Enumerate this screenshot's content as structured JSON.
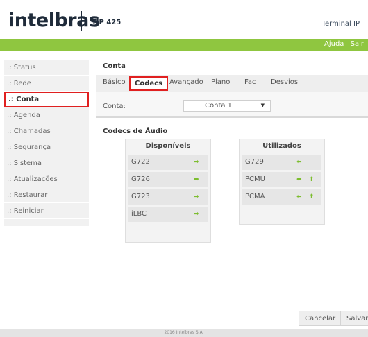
{
  "header": {
    "logo": "intelbras",
    "model": "TIP 425",
    "title": "Terminal IP"
  },
  "topbar": {
    "help": "Ajuda",
    "logout": "Sair"
  },
  "sidebar": {
    "items": [
      {
        "label": ".: Status"
      },
      {
        "label": ".: Rede"
      },
      {
        "label": ".: Conta"
      },
      {
        "label": ".: Agenda"
      },
      {
        "label": ".: Chamadas"
      },
      {
        "label": ".: Segurança"
      },
      {
        "label": ".: Sistema"
      },
      {
        "label": ".: Atualizações"
      },
      {
        "label": ".: Restaurar"
      },
      {
        "label": ".: Reiniciar"
      }
    ]
  },
  "main": {
    "title": "Conta",
    "tabs": [
      "Básico",
      "Codecs",
      "Avançado",
      "Plano",
      "Fac",
      "Desvios"
    ],
    "account_label": "Conta:",
    "account_value": "Conta 1",
    "section_title": "Codecs de Áudio",
    "available": {
      "title": "Disponíveis",
      "items": [
        "G722",
        "G726",
        "G723",
        "iLBC"
      ]
    },
    "used": {
      "title": "Utilizados",
      "items": [
        "G729",
        "PCMU",
        "PCMA"
      ]
    },
    "cancel_label": "Cancelar",
    "save_label": "Salvar"
  },
  "footer": {
    "copyright": "2016 Intelbras S.A."
  },
  "colors": {
    "accent": "#8fc640",
    "highlight": "#e02020",
    "arrow": "#7cbd2e"
  },
  "icons": {
    "add": "arrow-right-icon",
    "remove": "arrow-left-icon",
    "move_up": "arrow-up-icon"
  }
}
